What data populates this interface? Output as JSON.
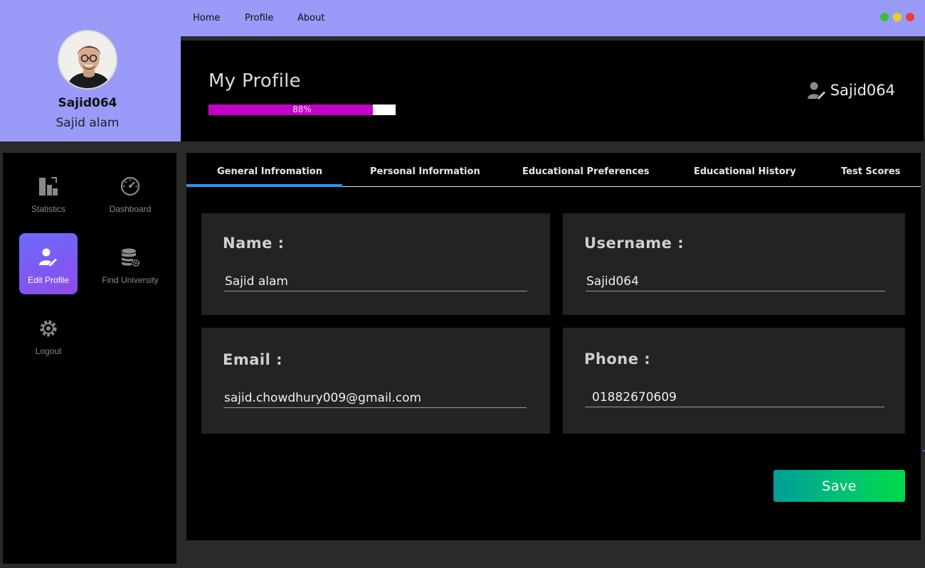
{
  "profile_card": {
    "username": "Sajid064",
    "fullname": "Sajid alam"
  },
  "menubar": {
    "items": [
      "Home",
      "Profile",
      "About"
    ],
    "window_controls": [
      {
        "name": "maximize",
        "color": "#35c13a"
      },
      {
        "name": "minimize",
        "color": "#e8d21d"
      },
      {
        "name": "close",
        "color": "#ee3b3b"
      }
    ]
  },
  "header": {
    "title": "My Profile",
    "progress": {
      "value": 0.88,
      "label": "88%",
      "fill_color": "#c400c8"
    },
    "user_icon": "user-edit-icon",
    "username": "Sajid064"
  },
  "sidebar": {
    "items": [
      {
        "label": "Statistics",
        "icon": "statistics-icon",
        "active": false
      },
      {
        "label": "Dashboard",
        "icon": "dashboard-gauge-icon",
        "active": false
      },
      {
        "label": "Edit Profile",
        "icon": "user-edit-icon",
        "active": true
      },
      {
        "label": "Find University",
        "icon": "database-gear-icon",
        "active": false
      },
      {
        "label": "Logout",
        "icon": "gear-icon",
        "active": false
      }
    ]
  },
  "tabs": {
    "items": [
      "General Infromation",
      "Personal Information",
      "Educational Preferences",
      "Educational History",
      "Test Scores"
    ],
    "active_index": 0,
    "accent_color": "#2f93e6"
  },
  "form": {
    "name": {
      "label": "Name :",
      "value": "Sajid alam"
    },
    "username": {
      "label": "Username :",
      "value": "Sajid064"
    },
    "email": {
      "label": "Email :",
      "value": "sajid.chowdhury009@gmail.com"
    },
    "phone": {
      "label": "Phone :",
      "value": "01882670609"
    },
    "save_label": "Save"
  }
}
